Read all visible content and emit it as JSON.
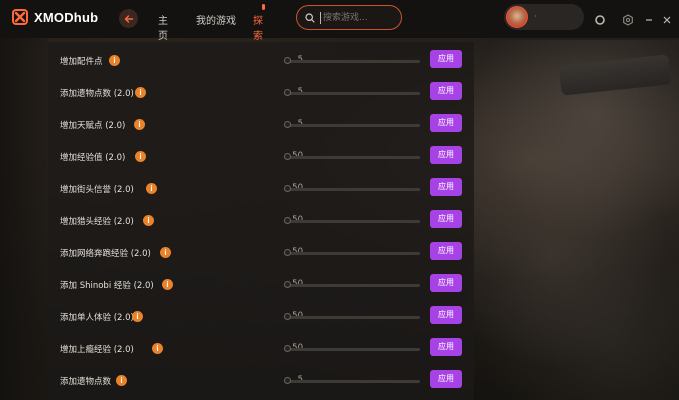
{
  "app": {
    "name": "XMODhub"
  },
  "nav": {
    "items": [
      "主页",
      "我的游戏",
      "探索"
    ],
    "active": "探索"
  },
  "search": {
    "placeholder": "搜索游戏..."
  },
  "user": {
    "name": "·"
  },
  "icons": {
    "logo": "xmod-logo-icon",
    "back": "arrow-left-icon",
    "search": "search-icon",
    "record": "circle-icon",
    "settings": "hexagon-gear-icon",
    "minimize": "minimize-icon",
    "close": "close-icon",
    "info": "info-icon"
  },
  "colors": {
    "accent": "#ff6a3d",
    "apply_button": "#a743e6",
    "info_badge": "#e8832c"
  },
  "cheats": [
    {
      "label": "增加配件点",
      "value": "5",
      "apply": "应用"
    },
    {
      "label": "添加遗物点数 (2.0)",
      "value": "5",
      "apply": "应用"
    },
    {
      "label": "增加天赋点 (2.0)",
      "value": "5",
      "apply": "应用"
    },
    {
      "label": "增加经验值 (2.0)",
      "value": "50",
      "apply": "应用"
    },
    {
      "label": "增加街头信誉 (2.0)",
      "value": "50",
      "apply": "应用"
    },
    {
      "label": "增加猎头经验 (2.0)",
      "value": "50",
      "apply": "应用"
    },
    {
      "label": "添加网络奔跑经验 (2.0)",
      "value": "50",
      "apply": "应用"
    },
    {
      "label": "添加 Shinobi 经验 (2.0)",
      "value": "50",
      "apply": "应用"
    },
    {
      "label": "添加单人体验 (2.0)",
      "value": "50",
      "apply": "应用"
    },
    {
      "label": "增加上瘾经验 (2.0)",
      "value": "50",
      "apply": "应用"
    },
    {
      "label": "添加遗物点数",
      "value": "5",
      "apply": "应用"
    }
  ]
}
